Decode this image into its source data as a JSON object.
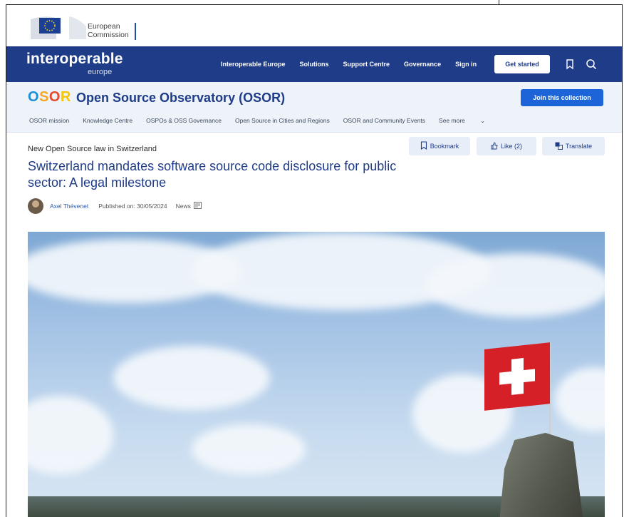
{
  "ec_header": {
    "org_line1": "European",
    "org_line2": "Commission"
  },
  "topnav": {
    "brand": "interoperable",
    "brand_sub": "europe",
    "links": [
      "Interoperable Europe",
      "Solutions",
      "Support Centre",
      "Governance",
      "Sign in"
    ],
    "get_started": "Get started",
    "icons": [
      "bookmark-icon",
      "search-icon"
    ]
  },
  "osor": {
    "logo_letters": [
      "O",
      "S",
      "O",
      "R"
    ],
    "title": "Open Source Observatory (OSOR)",
    "join_button": "Join this collection",
    "subnav": [
      "OSOR mission",
      "Knowledge Centre",
      "OSPOs & OSS Governance",
      "Open Source in Cities and Regions",
      "OSOR and Community Events",
      "See more"
    ]
  },
  "article": {
    "actions": {
      "bookmark": "Bookmark",
      "like": "Like (2)",
      "translate": "Translate"
    },
    "kicker": "New Open Source law in Switzerland",
    "title": "Switzerland mandates software source code disclosure for public sector: A legal milestone",
    "author": "Axel Thévenet",
    "published": "Published on: 30/05/2024",
    "type": "News"
  },
  "colors": {
    "nav": "#1f3c88",
    "osor_bg": "#eef3fa",
    "accent": "#1d64d8"
  }
}
